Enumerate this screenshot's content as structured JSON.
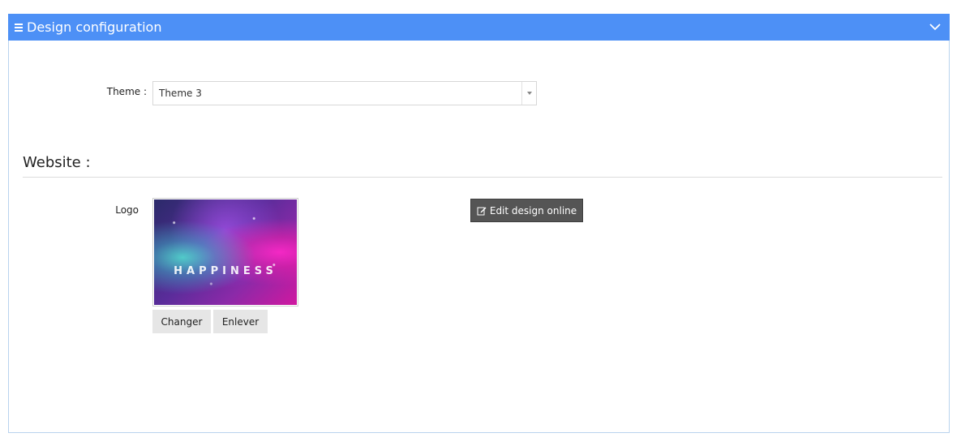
{
  "panel": {
    "title": "Design configuration",
    "icons": {
      "menu": "hamburger-icon",
      "collapse": "chevron-down-icon"
    }
  },
  "theme": {
    "label": "Theme :",
    "selected": "Theme 3"
  },
  "website": {
    "section_title": "Website :",
    "logo_label": "Logo",
    "logo_text": "HAPPINESS",
    "change_label": "Changer",
    "remove_label": "Enlever",
    "edit_label": "Edit design online",
    "edit_icon": "edit-icon"
  },
  "colors": {
    "header": "#4d90f6",
    "panel_border": "#b9d3ee",
    "dark_button": "#555555",
    "light_button": "#e6e6e6"
  }
}
